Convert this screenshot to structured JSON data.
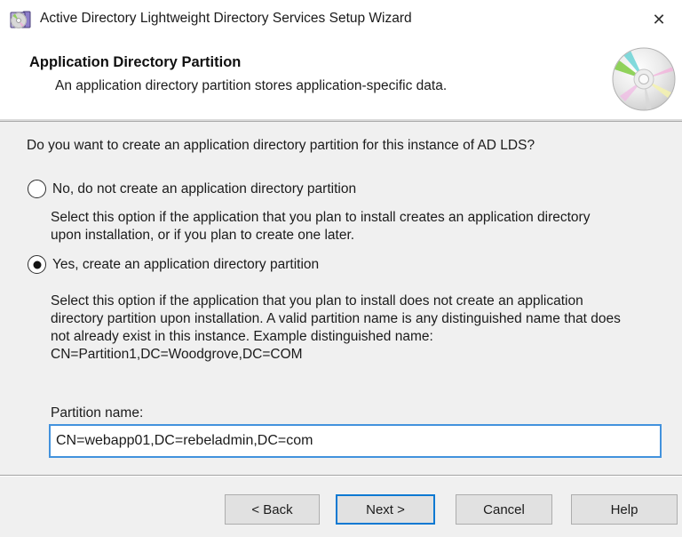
{
  "window": {
    "title": "Active Directory Lightweight Directory Services Setup Wizard"
  },
  "icons": {
    "close": "✕",
    "app_icon_name": "adlds-setup-icon",
    "header_icon_name": "cd-disc-icon"
  },
  "header": {
    "title": "Application Directory Partition",
    "subtitle": "An application directory partition stores application-specific data."
  },
  "main": {
    "question": "Do you want to create an application directory partition for this instance of AD LDS?",
    "option_no": {
      "label": "No, do not create an application directory partition",
      "selected": false,
      "desc_lines": [
        "Select this option if the application that you plan to install creates an application directory",
        "upon installation, or if you plan to create one later."
      ]
    },
    "option_yes": {
      "label": "Yes, create an application directory partition",
      "selected": true,
      "desc_lines": [
        "Select this option if the application that you plan to install does not create an application",
        "directory partition upon installation. A valid partition name is any distinguished name that does",
        "not already exist in this instance. Example distinguished name:",
        "CN=Partition1,DC=Woodgrove,DC=COM"
      ]
    },
    "partition_field": {
      "label": "Partition name:",
      "value": "CN=webapp01,DC=rebeladmin,DC=com"
    }
  },
  "footer": {
    "buttons": [
      {
        "label": "< Back"
      },
      {
        "label": "Next >",
        "default": true
      },
      {
        "label": "Cancel"
      },
      {
        "label": "Help"
      }
    ]
  },
  "colors": {
    "body_bg": "#f0f0f0",
    "titlebar_bg": "#ffffff",
    "focus_blue": "#0c79d2",
    "input_border_blue": "#4292dd",
    "button_bg": "#e1e1e1",
    "button_border": "#adadad"
  }
}
